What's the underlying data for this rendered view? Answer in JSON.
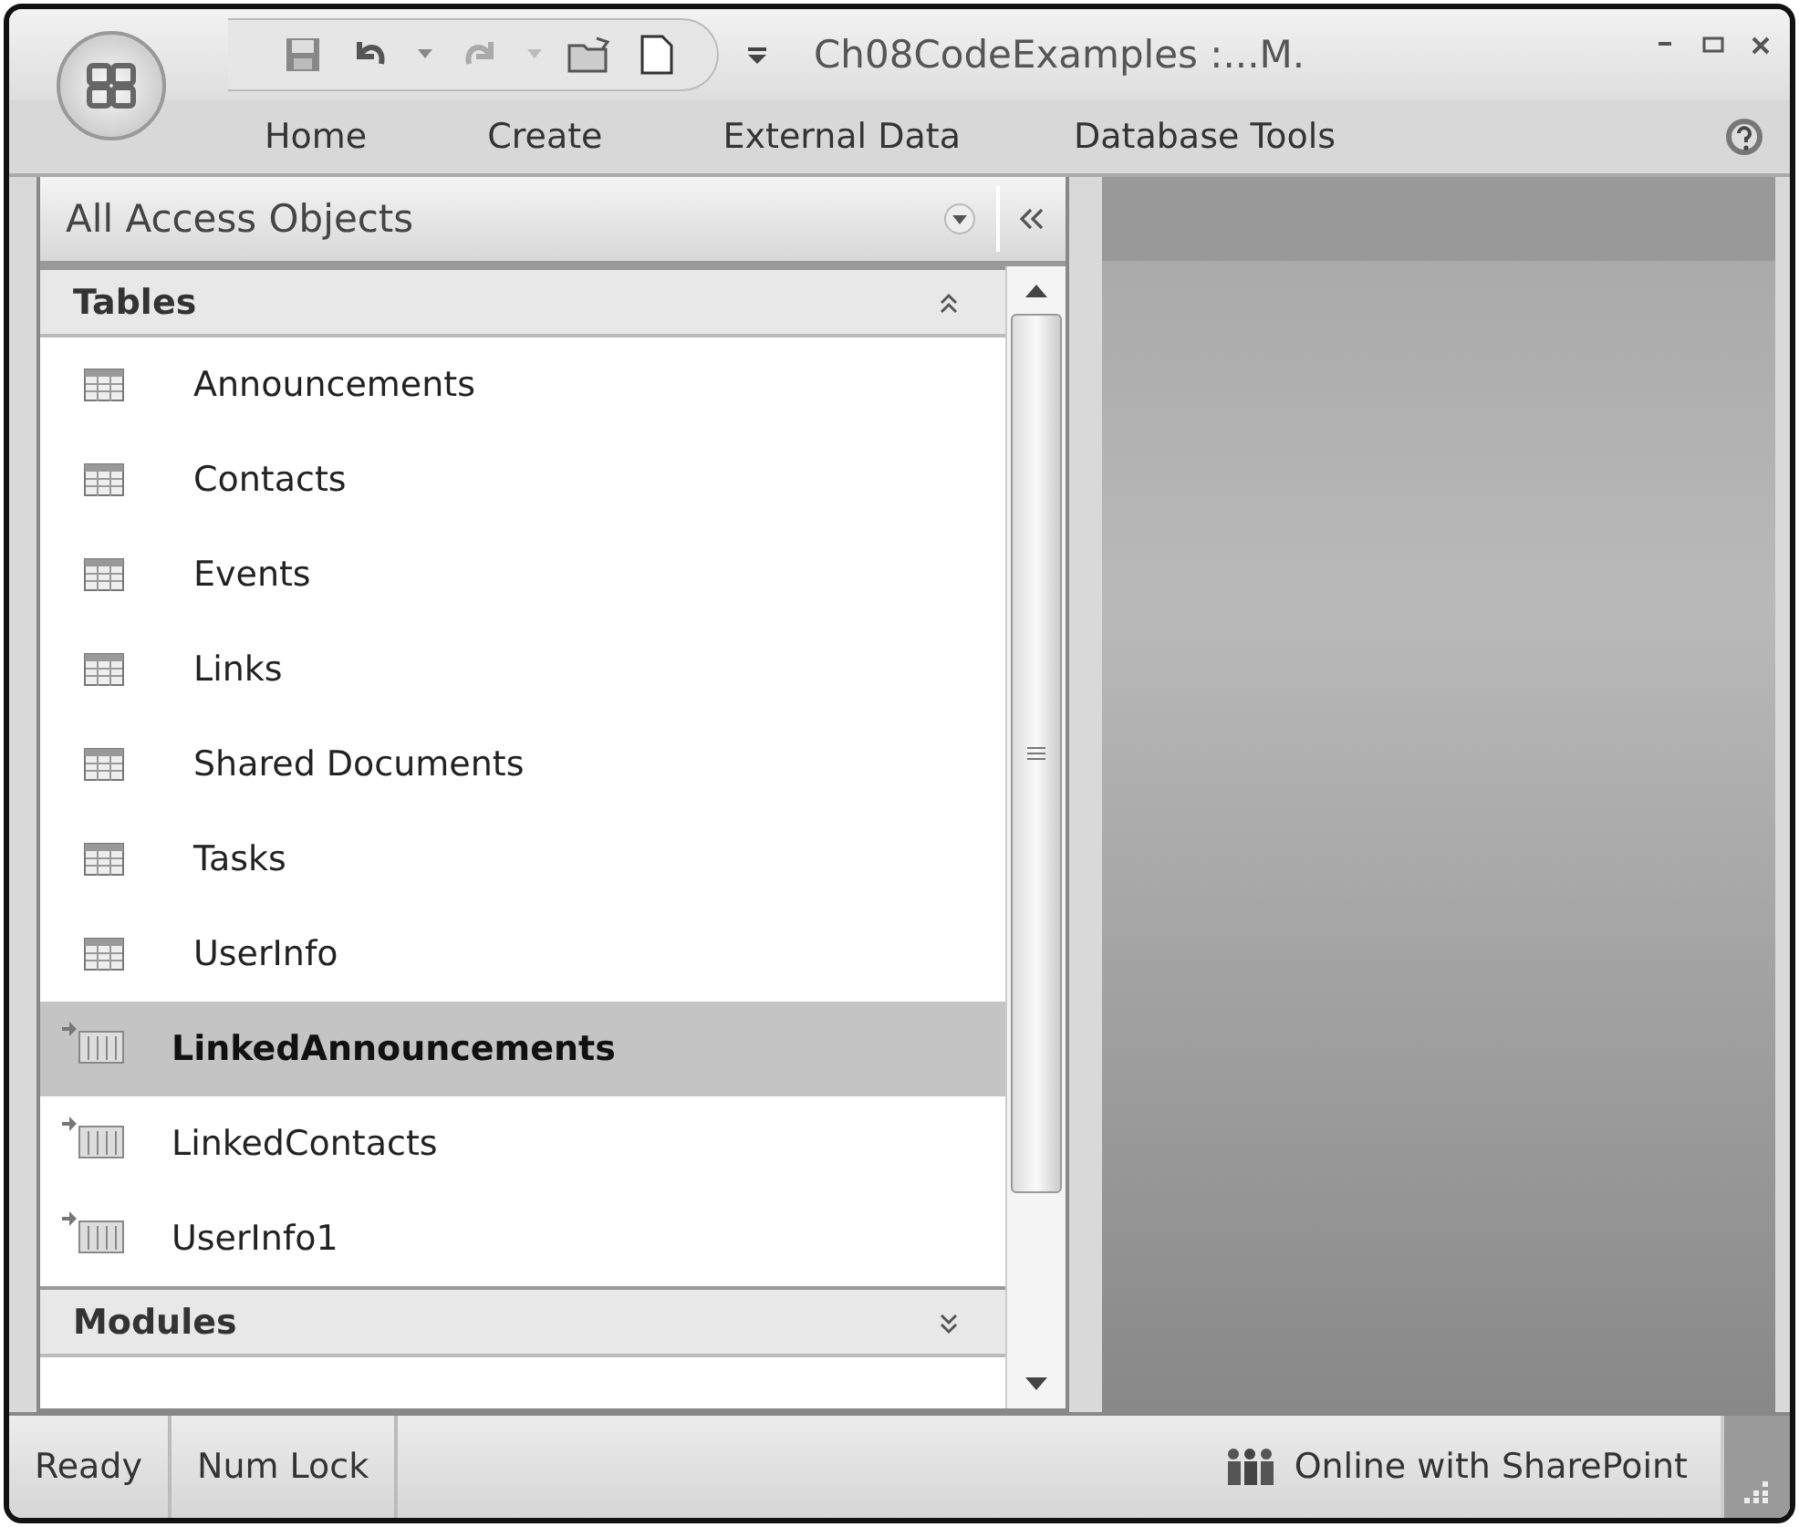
{
  "window": {
    "title": "Ch08CodeExamples :...M."
  },
  "ribbon_tabs": [
    {
      "label": "Home",
      "selected": false
    },
    {
      "label": "Create",
      "selected": false
    },
    {
      "label": "External Data",
      "selected": false
    },
    {
      "label": "Database Tools",
      "selected": false
    }
  ],
  "navigation_pane": {
    "title": "All Access Objects",
    "groups": [
      {
        "label": "Tables",
        "expanded": true,
        "items": [
          {
            "label": "Announcements",
            "kind": "local",
            "selected": false
          },
          {
            "label": "Contacts",
            "kind": "local",
            "selected": false
          },
          {
            "label": "Events",
            "kind": "local",
            "selected": false
          },
          {
            "label": "Links",
            "kind": "local",
            "selected": false
          },
          {
            "label": "Shared Documents",
            "kind": "local",
            "selected": false
          },
          {
            "label": "Tasks",
            "kind": "local",
            "selected": false
          },
          {
            "label": "UserInfo",
            "kind": "local",
            "selected": false
          },
          {
            "label": "LinkedAnnouncements",
            "kind": "linked",
            "selected": true
          },
          {
            "label": "LinkedContacts",
            "kind": "linked",
            "selected": false
          },
          {
            "label": "UserInfo1",
            "kind": "linked",
            "selected": false
          }
        ]
      },
      {
        "label": "Modules",
        "expanded": false
      }
    ]
  },
  "status_bar": {
    "left": [
      "Ready",
      "Num Lock"
    ],
    "right": "Online with SharePoint"
  }
}
